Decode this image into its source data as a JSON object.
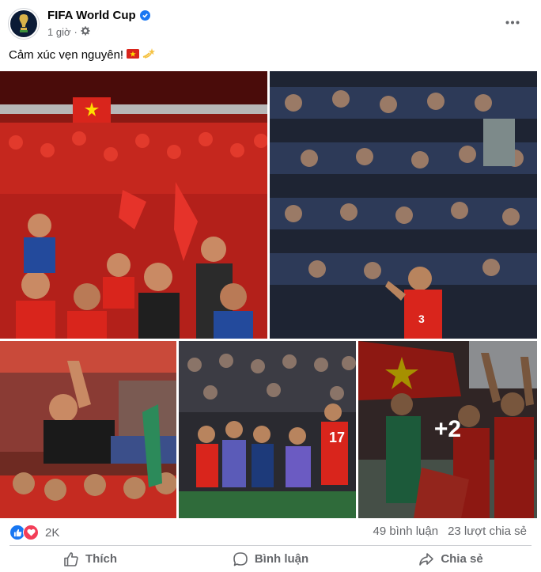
{
  "post": {
    "author": "FIFA World Cup",
    "verified": true,
    "time": "1 giờ",
    "privacy_icon": "gear-icon",
    "caption": "Cảm xúc vẹn nguyên!",
    "caption_emojis": [
      "vietnam-flag-emoji",
      "dizzy-emoji"
    ]
  },
  "gallery": {
    "photo_count_total": 7,
    "more_overlay": "+2"
  },
  "stats": {
    "reactions": [
      "like",
      "love"
    ],
    "reaction_count": "2K",
    "comments": "49 bình luận",
    "shares": "23 lượt chia sẻ"
  },
  "actions": {
    "like": "Thích",
    "comment": "Bình luận",
    "share": "Chia sẻ"
  },
  "colors": {
    "brand_blue": "#1877f2",
    "love_red": "#f33e58",
    "secondary_text": "#65676b",
    "vietnam_red": "#d9251c",
    "vietnam_yellow": "#ffde00"
  }
}
